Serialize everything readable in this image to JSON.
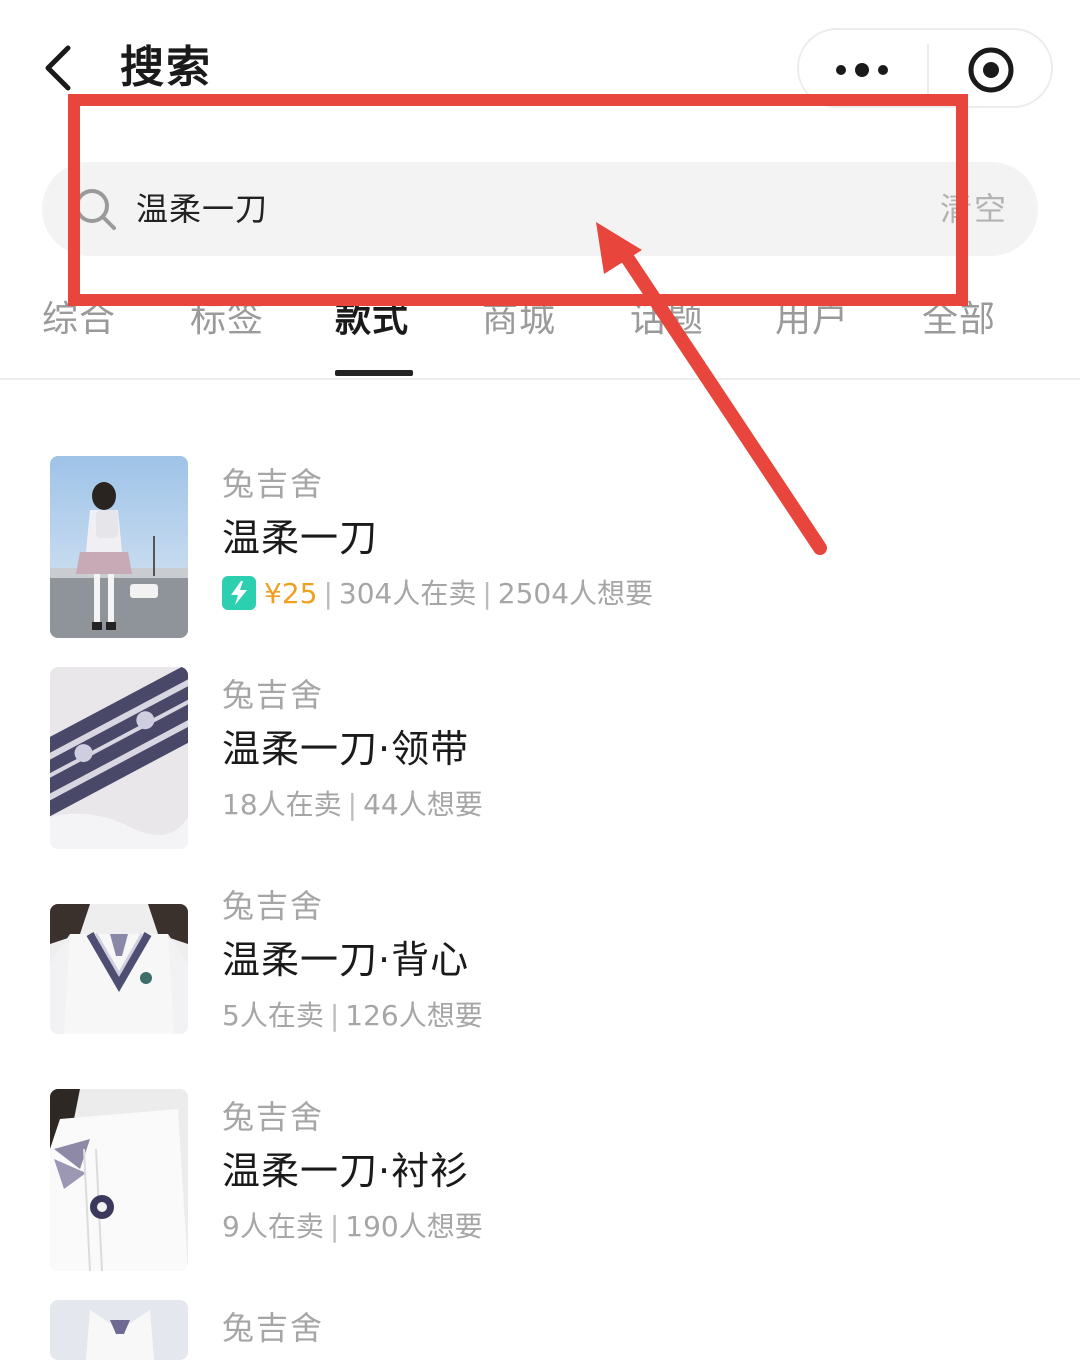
{
  "header": {
    "title": "搜索",
    "back_icon": "chevron-left-icon",
    "more_icon": "more-dots-icon",
    "close_icon": "target-icon"
  },
  "search": {
    "query": "温柔一刀",
    "clear_label": "清空",
    "icon": "search-icon"
  },
  "tabs": [
    {
      "label": "综合"
    },
    {
      "label": "标签"
    },
    {
      "label": "款式",
      "active": true
    },
    {
      "label": "商城"
    },
    {
      "label": "话题"
    },
    {
      "label": "用户"
    },
    {
      "label": "全部"
    }
  ],
  "results": [
    {
      "brand": "兔吉舍",
      "name": "温柔一刀",
      "price": "¥25",
      "sellers": "304人在卖",
      "wants": "2504人想要",
      "has_flash": true
    },
    {
      "brand": "兔吉舍",
      "name": "温柔一刀·领带",
      "sellers": "18人在卖",
      "wants": "44人想要"
    },
    {
      "brand": "兔吉舍",
      "name": "温柔一刀·背心",
      "sellers": "5人在卖",
      "wants": "126人想要"
    },
    {
      "brand": "兔吉舍",
      "name": "温柔一刀·衬衫",
      "sellers": "9人在卖",
      "wants": "190人想要"
    },
    {
      "brand": "兔吉舍"
    }
  ],
  "colors": {
    "annotation": "#e8463c",
    "price": "#f0a020",
    "flash_badge": "#2ccfb0",
    "muted_text": "#a6a6a6"
  }
}
